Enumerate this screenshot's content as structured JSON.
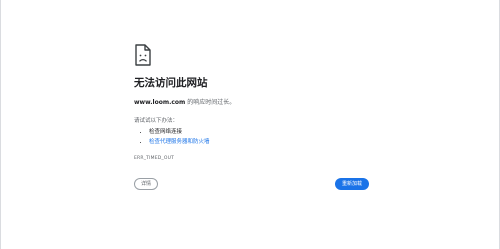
{
  "error_page": {
    "icon": "sad-page-icon",
    "title": "无法访问此网站",
    "description": {
      "host": "www.loom.com",
      "message": " 的响应时间过长。"
    },
    "try_label": "请试试以下办法：",
    "suggestions": [
      {
        "label": "检查网络连接",
        "is_link": false
      },
      {
        "label": "检查代理服务器和防火墙",
        "is_link": true
      }
    ],
    "error_code": "ERR_TIMED_OUT",
    "details_button": "详情",
    "reload_button": "重新加载"
  },
  "colors": {
    "accent": "#1a73e8",
    "text_primary": "#202124",
    "text_secondary": "#5f6368",
    "border": "#9aa0a6"
  }
}
